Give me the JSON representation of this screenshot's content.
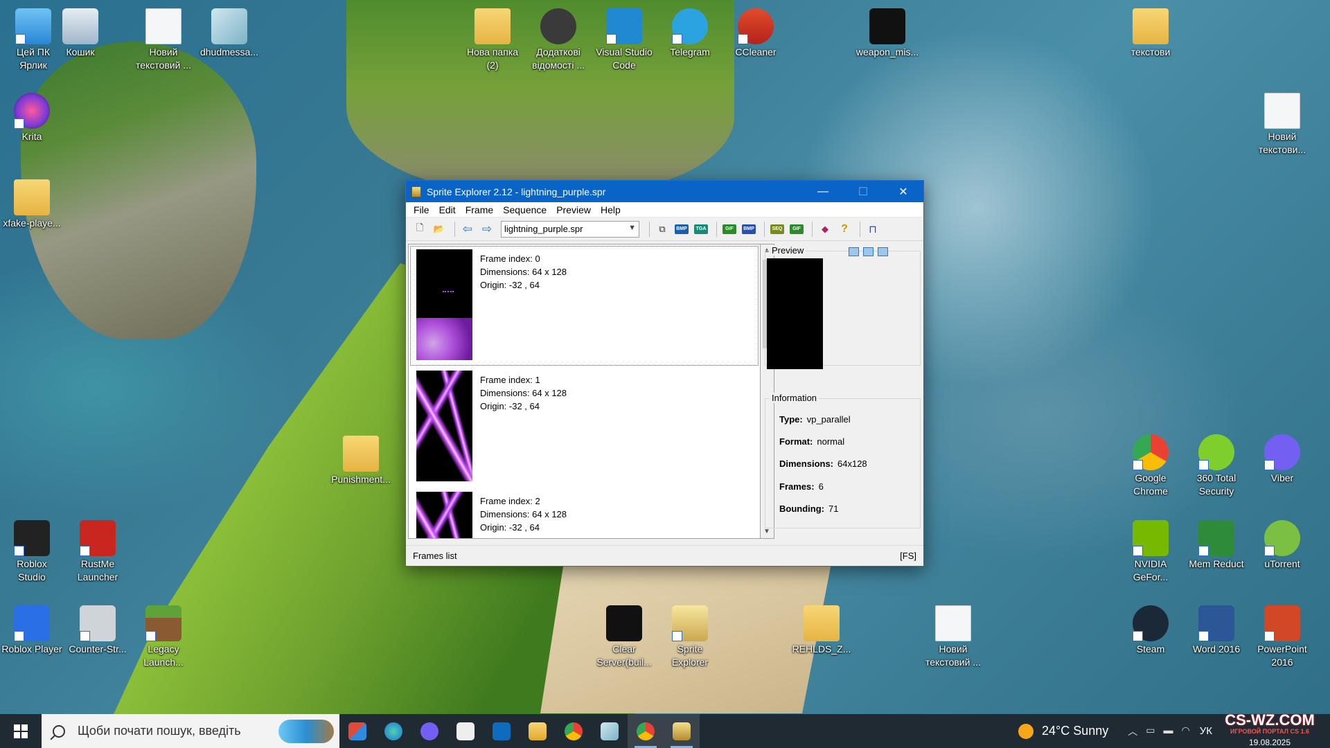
{
  "desktop": {
    "icons": [
      {
        "label": "Цей ПК\nЯрлик",
        "icon": "computer-icon"
      },
      {
        "label": "Кошик",
        "icon": "recycle-bin-icon"
      },
      {
        "label": "Новий\nтекстовий ...",
        "icon": "text-document-icon"
      },
      {
        "label": "dhudmessa...",
        "icon": "file-icon"
      },
      {
        "label": "Krita",
        "icon": "krita-icon"
      },
      {
        "label": "xfake-playe...",
        "icon": "folder-icon"
      },
      {
        "label": "Нова папка\n(2)",
        "icon": "folder-icon"
      },
      {
        "label": "Додаткові\nвідомості ...",
        "icon": "info-shortcut-icon"
      },
      {
        "label": "Visual Studio\nCode",
        "icon": "vscode-icon"
      },
      {
        "label": "Telegram",
        "icon": "telegram-icon"
      },
      {
        "label": "CCleaner",
        "icon": "ccleaner-icon"
      },
      {
        "label": "weapon_mis...",
        "icon": "folder-icon"
      },
      {
        "label": "текстови",
        "icon": "folder-icon"
      },
      {
        "label": "Новий\nтекстови...",
        "icon": "text-document-icon"
      },
      {
        "label": "Punishment...",
        "icon": "folder-icon"
      },
      {
        "label": "Google\nChrome",
        "icon": "chrome-icon"
      },
      {
        "label": "360 Total\nSecurity",
        "icon": "360-security-icon"
      },
      {
        "label": "Viber",
        "icon": "viber-icon"
      },
      {
        "label": "NVIDIA\nGeFor...",
        "icon": "nvidia-icon"
      },
      {
        "label": "Mem Reduct",
        "icon": "mem-reduct-icon"
      },
      {
        "label": "uTorrent",
        "icon": "utorrent-icon"
      },
      {
        "label": "Roblox\nStudio",
        "icon": "roblox-studio-icon"
      },
      {
        "label": "RustMe\nLauncher",
        "icon": "rustme-icon"
      },
      {
        "label": "Roblox Player",
        "icon": "roblox-icon"
      },
      {
        "label": "Counter-Str...",
        "icon": "counter-strike-icon"
      },
      {
        "label": "Legacy\nLaunch...",
        "icon": "minecraft-icon"
      },
      {
        "label": "Clear\nServer(buil...",
        "icon": "folder-icon"
      },
      {
        "label": "Sprite\nExplorer",
        "icon": "sprite-explorer-icon"
      },
      {
        "label": "REHLDS_Z...",
        "icon": "folder-icon"
      },
      {
        "label": "Новий\nтекстовий ...",
        "icon": "text-document-icon"
      },
      {
        "label": "Steam",
        "icon": "steam-icon"
      },
      {
        "label": "Word 2016",
        "icon": "word-icon"
      },
      {
        "label": "PowerPoint\n2016",
        "icon": "powerpoint-icon"
      }
    ]
  },
  "window": {
    "title": "Sprite Explorer 2.12 - lightning_purple.spr",
    "minimize": "—",
    "maximize": "☐",
    "close": "✕",
    "menu": [
      "File",
      "Edit",
      "Frame",
      "Sequence",
      "Preview",
      "Help"
    ],
    "file_combo": "lightning_purple.spr",
    "toolbar_labels": {
      "bmp": "BMP",
      "tga": "TGA",
      "gif": "GIF",
      "dib": "BMP",
      "seq": "SEQ",
      "ani": "GIF"
    },
    "frames": [
      {
        "index": "Frame index: 0",
        "dims": "Dimensions: 64 x 128",
        "origin": "Origin: -32 , 64"
      },
      {
        "index": "Frame index: 1",
        "dims": "Dimensions: 64 x 128",
        "origin": "Origin: -32 , 64"
      },
      {
        "index": "Frame index: 2",
        "dims": "Dimensions: 64 x 128",
        "origin": "Origin: -32 , 64"
      }
    ],
    "preview_label": "Preview",
    "info_label": "Information",
    "info": {
      "type_label": "Type:",
      "type": "vp_parallel",
      "format_label": "Format:",
      "format": "normal",
      "dims_label": "Dimensions:",
      "dims": "64x128",
      "frames_label": "Frames:",
      "frames": "6",
      "bounding_label": "Bounding:",
      "bounding": "71"
    },
    "status_left": "Frames list",
    "status_right": "[FS]"
  },
  "taskbar": {
    "search_placeholder": "Щоби почати пошук, введіть",
    "apps": [
      "start-menu-icon",
      "edge-icon",
      "viber-icon",
      "solitaire-icon",
      "outlook-icon",
      "explorer-icon",
      "chrome-icon",
      "glass-app-icon",
      "chrome-profile-icon",
      "sprite-explorer-icon"
    ],
    "weather": "24°C  Sunny",
    "lang": "УК",
    "watermark": "CS-WZ.COM",
    "watermark_sub": "ИГРОВОЙ ПОРТАЛ CS 1.6",
    "date": "19.08.2025"
  },
  "colors": {
    "accent": "#0a64c8",
    "taskbar": "#1f2a33"
  }
}
